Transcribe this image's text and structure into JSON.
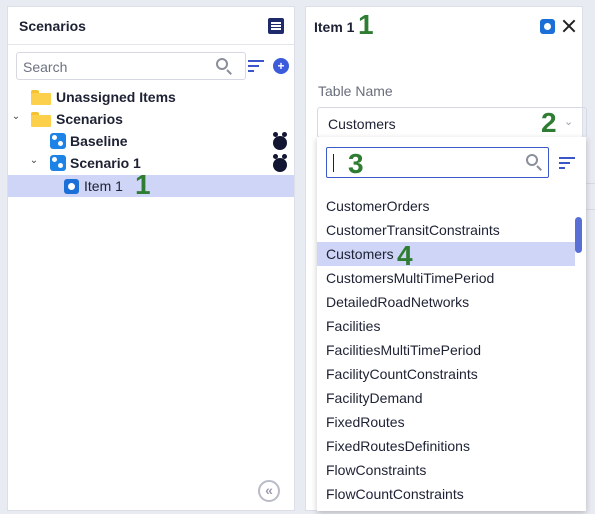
{
  "scenarios_panel": {
    "title": "Scenarios",
    "search_placeholder": "Search",
    "add_symbol": "+",
    "tree": [
      {
        "label": "Unassigned Items",
        "icon": "folder-icon"
      },
      {
        "label": "Scenarios",
        "icon": "folder-icon",
        "expanded_symbol": "⌄"
      },
      {
        "label": "Baseline",
        "icon": "scenario-icon"
      },
      {
        "label": "Scenario 1",
        "icon": "scenario-icon",
        "expanded_symbol": "⌄"
      },
      {
        "label": "Item 1",
        "icon": "item-icon",
        "selected": true
      }
    ],
    "collapse_symbol": "«"
  },
  "detail_panel": {
    "title": "Item 1",
    "field_label": "Table Name",
    "selected_value": "Customers",
    "dropdown_chevron": "⌄"
  },
  "dropdown": {
    "search_value": "",
    "options": [
      "CustomerOrders",
      "CustomerTransitConstraints",
      "Customers",
      "CustomersMultiTimePeriod",
      "DetailedRoadNetworks",
      "Facilities",
      "FacilitiesMultiTimePeriod",
      "FacilityCountConstraints",
      "FacilityDemand",
      "FixedRoutes",
      "FixedRoutesDefinitions",
      "FlowConstraints",
      "FlowCountConstraints"
    ],
    "selected_option": "Customers"
  },
  "annotations": {
    "one_tree": "1",
    "one_title": "1",
    "two": "2",
    "three": "3",
    "four": "4"
  },
  "colors": {
    "selection": "#cfd5f6",
    "brand_blue": "#1d6fd8",
    "annotation_green": "#2e7d32",
    "folder_yellow": "#fcd04b"
  }
}
